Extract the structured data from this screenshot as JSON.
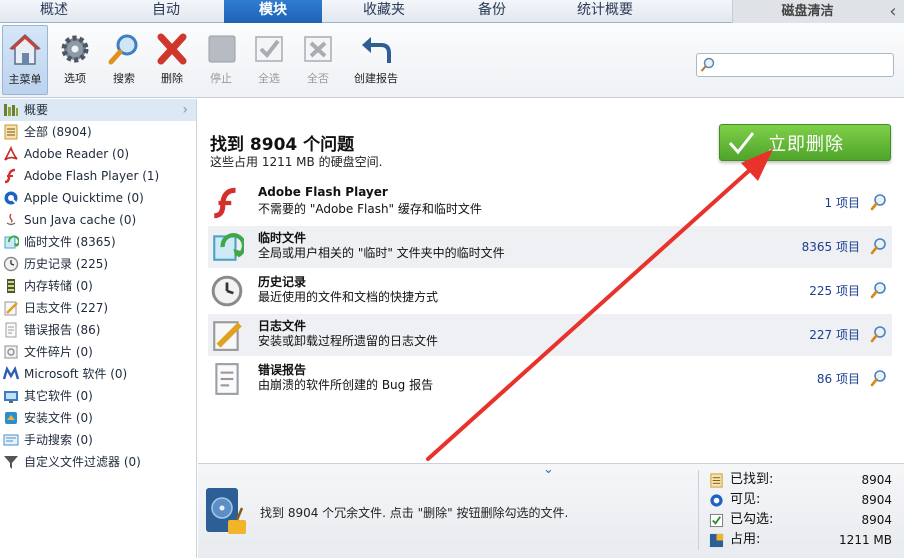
{
  "tabs": [
    {
      "label": "概述",
      "active": false
    },
    {
      "label": "自动",
      "active": false
    },
    {
      "label": "模块",
      "active": true
    },
    {
      "label": "收藏夹",
      "active": false
    },
    {
      "label": "备份",
      "active": false
    },
    {
      "label": "统计概要",
      "active": false
    }
  ],
  "panel_title": "磁盘清洁",
  "toolbar": {
    "home": "主菜单",
    "options": "选项",
    "search": "搜索",
    "delete": "删除",
    "stop": "停止",
    "select_all": "全选",
    "select_none": "全否",
    "create_report": "创建报告"
  },
  "search_box": {
    "value": "",
    "placeholder": ""
  },
  "sidebar": {
    "items": [
      {
        "label": "概要",
        "icon": "summary-icon",
        "color": "#6b7f2e"
      },
      {
        "label": "全部 (8904)",
        "icon": "checklist-icon",
        "color": "#c79a2d"
      },
      {
        "label": "Adobe Reader (0)",
        "icon": "adobe-reader-icon",
        "color": "#c62828"
      },
      {
        "label": "Adobe Flash Player (1)",
        "icon": "flash-icon",
        "color": "#d32f2f"
      },
      {
        "label": "Apple Quicktime (0)",
        "icon": "quicktime-icon",
        "color": "#1e63c4"
      },
      {
        "label": "Sun Java cache (0)",
        "icon": "java-icon",
        "color": "#6d6d6d"
      },
      {
        "label": "临时文件 (8365)",
        "icon": "temp-files-icon",
        "color": "#3da84a"
      },
      {
        "label": "历史记录 (225)",
        "icon": "history-icon",
        "color": "#8a8a8a"
      },
      {
        "label": "内存转储 (0)",
        "icon": "memory-dump-icon",
        "color": "#4a5a2e"
      },
      {
        "label": "日志文件 (227)",
        "icon": "log-file-icon",
        "color": "#e0a020"
      },
      {
        "label": "错误报告 (86)",
        "icon": "error-report-icon",
        "color": "#9aa0a6"
      },
      {
        "label": "文件碎片 (0)",
        "icon": "file-fragment-icon",
        "color": "#8f8f8f"
      },
      {
        "label": "Microsoft 软件 (0)",
        "icon": "microsoft-icon",
        "color": "#2d5fb0"
      },
      {
        "label": "其它软件 (0)",
        "icon": "other-software-icon",
        "color": "#3b7cc2"
      },
      {
        "label": "安装文件 (0)",
        "icon": "install-files-icon",
        "color": "#2a8fd0"
      },
      {
        "label": "手动搜索 (0)",
        "icon": "manual-search-icon",
        "color": "#4a90c8"
      },
      {
        "label": "自定义文件过滤器 (0)",
        "icon": "filter-icon",
        "color": "#555555"
      }
    ]
  },
  "main": {
    "headline": "找到 8904 个问题",
    "subline": "这些占用 1211 MB 的硬盘空间.",
    "delete_now": "立即删除",
    "results": [
      {
        "title": "Adobe Flash Player",
        "desc": "不需要的 \"Adobe Flash\" 缓存和临时文件",
        "count": "1 项目",
        "icon": "flash-icon"
      },
      {
        "title": "临时文件",
        "desc": "全局或用户相关的 \"临时\" 文件夹中的临时文件",
        "count": "8365 项目",
        "icon": "temp-files-icon"
      },
      {
        "title": "历史记录",
        "desc": "最近使用的文件和文档的快捷方式",
        "count": "225 项目",
        "icon": "history-icon"
      },
      {
        "title": "日志文件",
        "desc": "安装或卸载过程所遗留的日志文件",
        "count": "227 项目",
        "icon": "log-file-icon"
      },
      {
        "title": "错误报告",
        "desc": "由崩溃的软件所创建的 Bug 报告",
        "count": "86 项目",
        "icon": "error-report-icon"
      }
    ]
  },
  "bottom": {
    "message": "找到 8904 个冗余文件. 点击 \"删除\" 按钮删除勾选的文件.",
    "stats": [
      {
        "label": "已找到:",
        "value": "8904",
        "icon": "found-icon"
      },
      {
        "label": "可见:",
        "value": "8904",
        "icon": "visible-icon"
      },
      {
        "label": "已勾选:",
        "value": "8904",
        "icon": "checked-icon"
      },
      {
        "label": "占用:",
        "value": "1211 MB",
        "icon": "disk-usage-icon"
      }
    ]
  },
  "colors": {
    "accent_tab": "#1f62b5",
    "delete_button": "#4fa52a",
    "annotation_arrow": "#e8322b",
    "count_link": "#1b3f8f"
  }
}
